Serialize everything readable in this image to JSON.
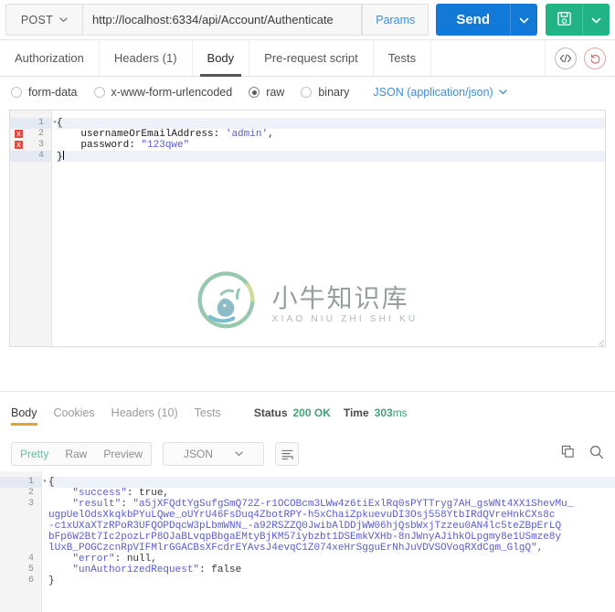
{
  "urlbar": {
    "method": "POST",
    "url": "http://localhost:6334/api/Account/Authenticate",
    "params_label": "Params",
    "send_label": "Send",
    "send_caret_icon": "chevron-down-icon",
    "save_icon": "floppy-save-icon",
    "save_caret_icon": "chevron-down-icon",
    "accent_blue": "#1379d6",
    "accent_green": "#21b383",
    "link_blue": "#3f8cd9"
  },
  "request_tabs": {
    "items": [
      {
        "label": "Authorization",
        "active": false
      },
      {
        "label": "Headers (1)",
        "active": false
      },
      {
        "label": "Body",
        "active": true
      },
      {
        "label": "Pre-request script",
        "active": false
      },
      {
        "label": "Tests",
        "active": false
      }
    ],
    "code_icon": "code-brackets-icon",
    "reset_icon": "undo-reset-icon"
  },
  "body_type": {
    "options": [
      {
        "label": "form-data",
        "selected": false
      },
      {
        "label": "x-www-form-urlencoded",
        "selected": false
      },
      {
        "label": "raw",
        "selected": true
      },
      {
        "label": "binary",
        "selected": false
      }
    ],
    "content_type": "JSON (application/json)",
    "content_type_caret": "chevron-down-icon"
  },
  "request_editor": {
    "lines": [
      {
        "num": "1",
        "text": "{",
        "fold": true,
        "error": false,
        "highlight": true
      },
      {
        "num": "2",
        "text": "    usernameOrEmailAddress: 'admin',",
        "fold": false,
        "error": true,
        "highlight": false
      },
      {
        "num": "3",
        "text": "    password: \"123qwe\"",
        "fold": false,
        "error": true,
        "highlight": false
      },
      {
        "num": "4",
        "text": "}",
        "fold": false,
        "error": false,
        "highlight": true
      }
    ],
    "line1_prefix": "{",
    "line2_key": "    usernameOrEmailAddress: ",
    "line2_val": "'admin'",
    "line2_suffix": ",",
    "line3_key": "    password: ",
    "line3_val": "\"123qwe\"",
    "line4": "}",
    "error_marker": "x"
  },
  "watermark": {
    "cn": "小牛知识库",
    "en": "XIAO NIU ZHI SHI KU",
    "logo_icon": "bull-circle-logo-icon"
  },
  "response_tabs": {
    "items": [
      {
        "label": "Body",
        "active": true
      },
      {
        "label": "Cookies",
        "active": false
      },
      {
        "label": "Headers (10)",
        "active": false
      },
      {
        "label": "Tests",
        "active": false
      }
    ],
    "status_label": "Status",
    "status_value": "200 OK",
    "time_label": "Time",
    "time_value": "303",
    "time_unit": "ms"
  },
  "response_toolbar": {
    "view_modes": [
      {
        "label": "Pretty",
        "active": true
      },
      {
        "label": "Raw",
        "active": false
      },
      {
        "label": "Preview",
        "active": false
      }
    ],
    "format": "JSON",
    "format_caret": "chevron-down-icon",
    "wrap_icon": "word-wrap-icon",
    "copy_icon": "copy-icon",
    "search_icon": "search-icon"
  },
  "response_body": {
    "gutter": [
      "1",
      "2",
      "3",
      "",
      "",
      "",
      "",
      "4",
      "5",
      "6"
    ],
    "rows": [
      {
        "num": "1",
        "highlight": true,
        "segs": [
          {
            "t": "{",
            "c": "p"
          }
        ]
      },
      {
        "num": "2",
        "highlight": false,
        "segs": [
          {
            "t": "    \"success\"",
            "c": "k"
          },
          {
            "t": ": true,",
            "c": "p"
          }
        ]
      },
      {
        "num": "3",
        "highlight": false,
        "segs": [
          {
            "t": "    \"result\"",
            "c": "k"
          },
          {
            "t": ": ",
            "c": "p"
          },
          {
            "t": "\"a5jXFQdtYgSufgSmQ72Z-r1OCOBcm3LWw4z6tiExlRq0sPYTTryg7AH_gsWNt4XX1ShevMu_",
            "c": "k"
          }
        ]
      },
      {
        "num": "",
        "highlight": false,
        "segs": [
          {
            "t": "ugpUelOdsXkqkbPYuLQwe_oUYrU46FsDuq4ZbotRPY-h5xChaiZpkuevuDI3Osj558YtbIRdQVreHnkCXs8c",
            "c": "k"
          }
        ]
      },
      {
        "num": "",
        "highlight": false,
        "segs": [
          {
            "t": "-c1xUXaXTzRPoR3UFQOPDqcW3pLbmWNN_-a92RSZZQ0JwibAlDDjWW06hjQsbWxjTzzeu0AN4lc5teZBpErLQ",
            "c": "k"
          }
        ]
      },
      {
        "num": "",
        "highlight": false,
        "segs": [
          {
            "t": "bFp6W2Bt7Ic2pozLrP8OJaBLvqpBbgaEMtyBjKM57iybzbt1DSEmkVXHb-8nJWnyAJihkOLpgmy8e1USmze8y",
            "c": "k"
          }
        ]
      },
      {
        "num": "",
        "highlight": false,
        "segs": [
          {
            "t": "lUxB_POGCzcnRpVIFMlrGGACBsXFcdrEYAvsJ4evqC1Z074xeHrSgguErNhJuVDVSOVoqRXdCgm_GlgQ\",",
            "c": "k"
          }
        ]
      },
      {
        "num": "4",
        "highlight": false,
        "segs": [
          {
            "t": "    \"error\"",
            "c": "k"
          },
          {
            "t": ": null,",
            "c": "p"
          }
        ]
      },
      {
        "num": "5",
        "highlight": false,
        "segs": [
          {
            "t": "    \"unAuthorizedRequest\"",
            "c": "k"
          },
          {
            "t": ": false",
            "c": "p"
          }
        ]
      },
      {
        "num": "6",
        "highlight": false,
        "segs": [
          {
            "t": "}",
            "c": "p"
          }
        ]
      }
    ]
  }
}
